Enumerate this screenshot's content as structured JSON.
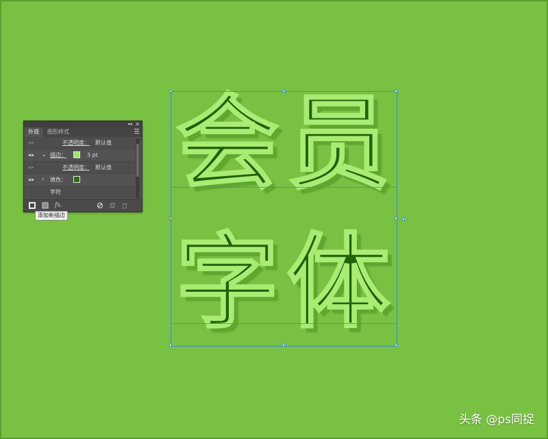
{
  "colors": {
    "canvas_bg": "#79c143",
    "glyph_fill": "#1f6208",
    "glyph_stroke": "#a8ec74",
    "selection": "#3a8bd6",
    "panel_bg": "#535353"
  },
  "panel": {
    "tabs": [
      {
        "label": "外观",
        "active": true
      },
      {
        "label": "图形样式",
        "active": false
      }
    ],
    "rows": {
      "opacity_top": {
        "label": "不透明度：",
        "value": "默认值"
      },
      "stroke": {
        "label": "描边：",
        "weight": "3 pt"
      },
      "opacity_mid": {
        "label": "不透明度：",
        "value": "默认值"
      },
      "fill": {
        "label": "填色："
      },
      "characters": {
        "label": "字符"
      }
    },
    "icons": {
      "collapse": "collapse-icon",
      "close": "close-icon",
      "menu": "panel-menu-icon",
      "visibility": "eye-icon",
      "add_stroke": "add-stroke-icon",
      "add_fill": "add-fill-icon",
      "fx": "fx-icon",
      "clear": "clear-appearance-icon",
      "duplicate": "duplicate-item-icon",
      "delete": "delete-item-icon"
    },
    "fx_label": "fx."
  },
  "tooltip": {
    "text": "添加新描边"
  },
  "artwork": {
    "glyphs": [
      "会",
      "员",
      "字",
      "体"
    ]
  },
  "watermark": {
    "text": "头条 @ps同捉"
  }
}
